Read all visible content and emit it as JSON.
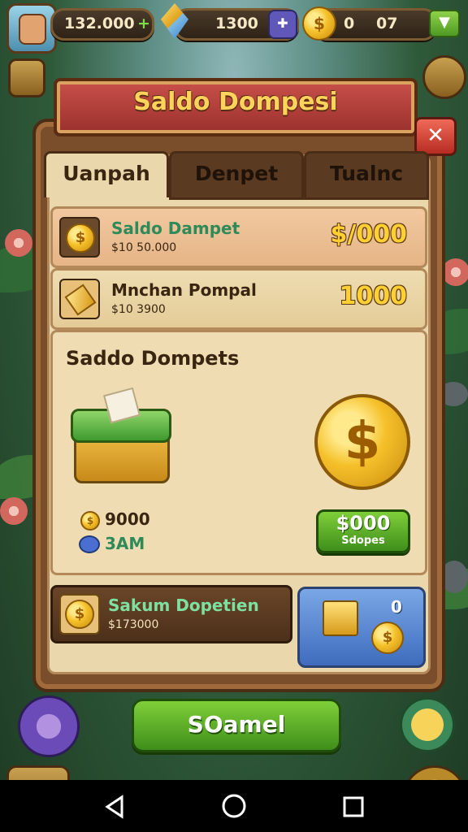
{
  "topbar": {
    "stat1": "132.000",
    "stat1_plus": "+",
    "stat2": "1300",
    "stat3_a": "0",
    "stat3_b": "07"
  },
  "title": "Saldo Dompesi",
  "close_label": "✕",
  "tabs": [
    "Uanpah",
    "Denpet",
    "Tualnc"
  ],
  "rows": [
    {
      "title": "Saldo Dampet",
      "sub": "$10 50.000",
      "value": "$/000"
    },
    {
      "title": "Mnchan Pompal",
      "sub": "$10 3900",
      "value": "1000"
    }
  ],
  "detail": {
    "heading": "Saddo Dompets",
    "stat_coin": "9000",
    "stat_gem": "3AM",
    "button_value": "$000",
    "button_sub": "Sdopes"
  },
  "bottom_row": {
    "title": "Sakum Dopetien",
    "sub": "$173000"
  },
  "chest_count": "0",
  "main_button": "SOamel",
  "colors": {
    "accent_green": "#5fb22a",
    "gold": "#ffcf33",
    "panel_brown": "#7a4e2a"
  }
}
